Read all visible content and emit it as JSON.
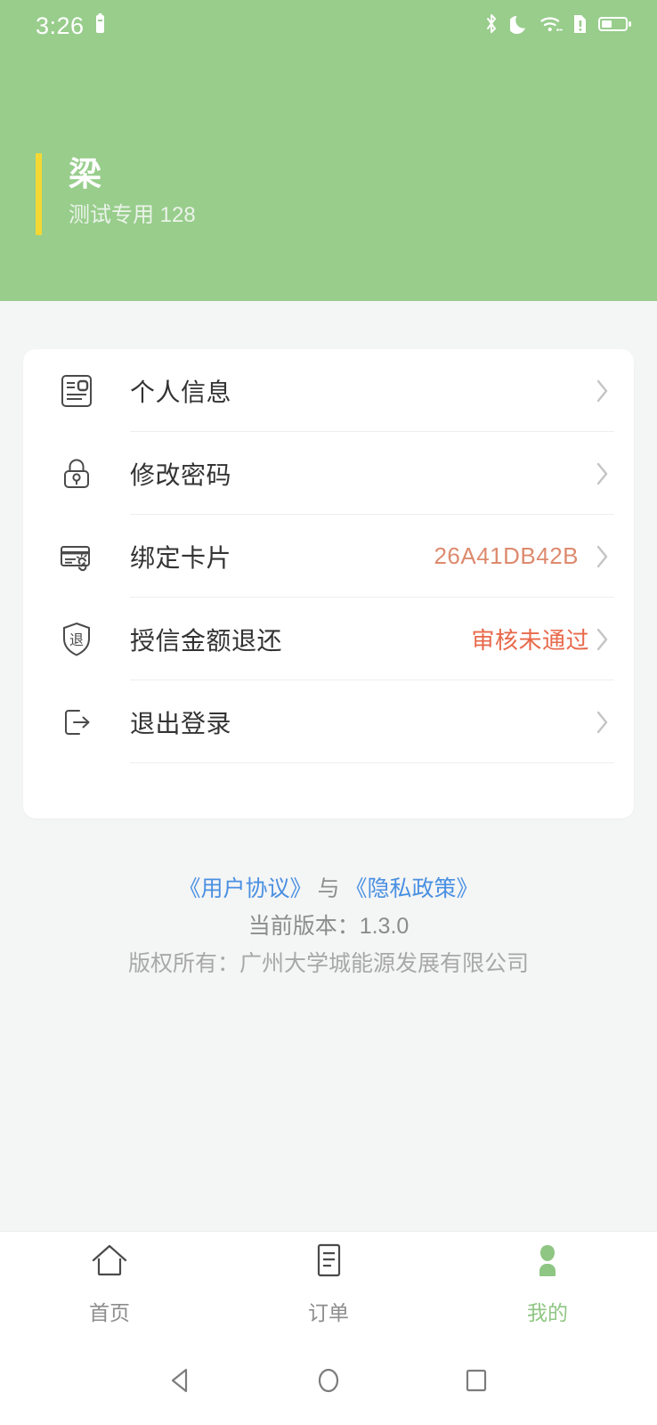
{
  "statusbar": {
    "time": "3:26",
    "icons": [
      "alarm-battery-icon",
      "bluetooth-icon",
      "do-not-disturb-moon-icon",
      "wifi-icon",
      "sim-alert-icon",
      "battery-icon"
    ]
  },
  "header": {
    "user_name": "梁",
    "user_subtitle": "测试专用 128",
    "accent_color": "#f5d833",
    "background_color": "#98cd8c"
  },
  "menu": {
    "items": [
      {
        "icon": "id-card-icon",
        "label": "个人信息",
        "value": "",
        "value_type": "none"
      },
      {
        "icon": "lock-icon",
        "label": "修改密码",
        "value": "",
        "value_type": "none"
      },
      {
        "icon": "bind-card-icon",
        "label": "绑定卡片",
        "value": "26A41DB42B",
        "value_type": "card-no"
      },
      {
        "icon": "shield-refund-icon",
        "label": "授信金额退还",
        "value": "审核未通过",
        "value_type": "status-fail"
      },
      {
        "icon": "logout-icon",
        "label": "退出登录",
        "value": "",
        "value_type": "none"
      }
    ],
    "chevron": "chevron-right-icon",
    "card_number_color": "#dd8a6e",
    "status_fail_color": "#e8684a"
  },
  "legal": {
    "user_agreement": "《用户协议》",
    "conjunction": "与",
    "privacy_policy": "《隐私政策》",
    "version": "当前版本：1.3.0",
    "copyright": "版权所有：广州大学城能源发展有限公司",
    "link_color": "#4a90e2"
  },
  "tabbar": {
    "active_color": "#8fc683",
    "inactive_color": "#8d8d8d",
    "tabs": [
      {
        "icon": "home-icon",
        "label": "首页",
        "active": false
      },
      {
        "icon": "order-list-icon",
        "label": "订单",
        "active": false
      },
      {
        "icon": "person-icon",
        "label": "我的",
        "active": true
      }
    ]
  },
  "androidnav": {
    "back": "back-triangle-icon",
    "home": "home-circle-icon",
    "recents": "recents-square-icon"
  }
}
